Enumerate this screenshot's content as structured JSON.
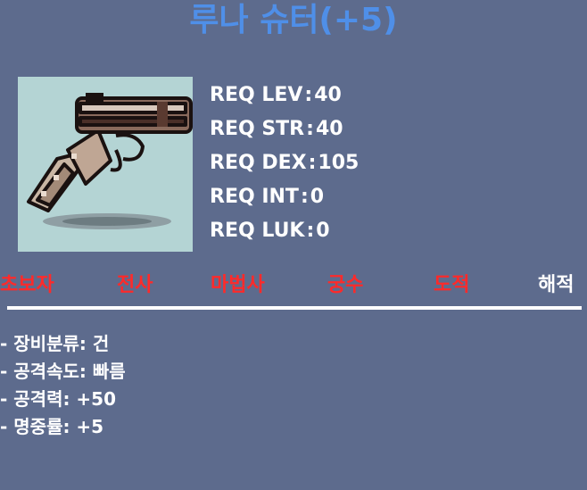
{
  "colors": {
    "background": "#5d6b8d",
    "title": "#4f8fe8",
    "text": "#ffffff",
    "job_disabled": "#ff2a2a",
    "job_enabled": "#ffffff",
    "item_bg": "#b4d4d4"
  },
  "item": {
    "name": "루나 슈터(+5)",
    "image_icon": "pistol-icon"
  },
  "requirements": [
    {
      "label": "REQ LEV",
      "value": "40"
    },
    {
      "label": "REQ STR",
      "value": "40"
    },
    {
      "label": "REQ DEX",
      "value": "105"
    },
    {
      "label": "REQ INT",
      "value": "0"
    },
    {
      "label": "REQ LUK",
      "value": "0"
    }
  ],
  "jobs": [
    {
      "label": "초보자",
      "enabled": false
    },
    {
      "label": "전사",
      "enabled": false
    },
    {
      "label": "마법사",
      "enabled": false
    },
    {
      "label": "궁수",
      "enabled": false
    },
    {
      "label": "도적",
      "enabled": false
    },
    {
      "label": "해적",
      "enabled": true
    }
  ],
  "stats": [
    "- 장비분류: 건",
    "- 공격속도: 빠름",
    "- 공격력: +50",
    "- 명중률: +5"
  ]
}
